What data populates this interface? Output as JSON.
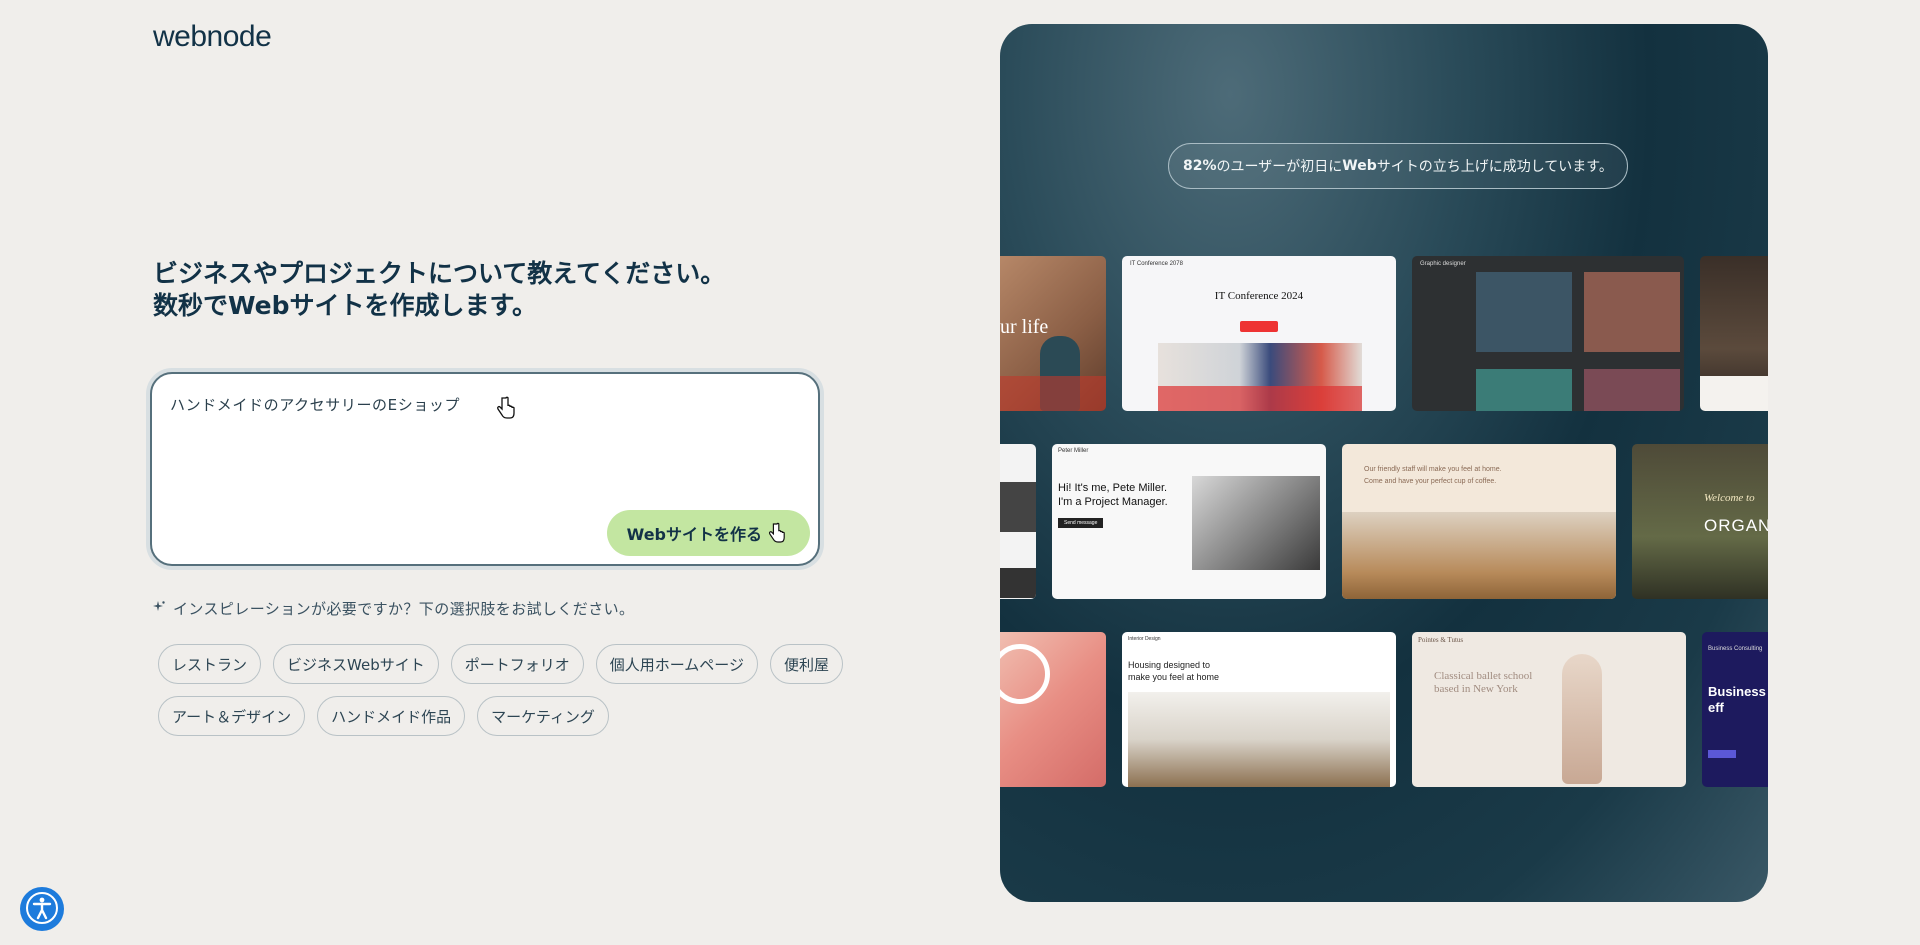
{
  "brand": {
    "logo_text": "webnode"
  },
  "headline": {
    "line1": "ビジネスやプロジェクトについて教えてください。",
    "line2": "数秒でWebサイトを作成します。"
  },
  "prompt": {
    "value": "ハンドメイドのアクセサリーのEショップ",
    "submit_label": "Webサイトを作る"
  },
  "inspiration": {
    "text": "インスピレーションが必要ですか？下の選択肢をお試しください。",
    "chips": [
      "レストラン",
      "ビジネスWebサイト",
      "ポートフォリオ",
      "個人用ホームページ",
      "便利屋",
      "アート＆デザイン",
      "ハンドメイド作品",
      "マーケティング"
    ]
  },
  "showcase": {
    "stat_highlight": "82%",
    "stat_rest": "のユーザーが初日に",
    "stat_bold2": "Web",
    "stat_tail": "サイトの立ち上げに成功しています。",
    "templates": {
      "yoga_text": "our life",
      "conf_small": "IT Conference 2078",
      "conf_title": "IT Conference 2024",
      "graphic_title": "Graphic designer",
      "pm_name": "Peter Miller",
      "pm_text1": "Hi! It's me, Pete Miller.",
      "pm_text2": "I'm a Project Manager.",
      "pm_btn": "Send message",
      "cafe_line1": "Our friendly staff will make you feel at home.",
      "cafe_line2": "Come and have your perfect cup of coffee.",
      "organic_text": "ORGAN",
      "organic_welcome": "Welcome to",
      "interior_brand": "Interior Design",
      "interior_title1": "Housing designed to",
      "interior_title2": "make you feel at home",
      "ballet_brand": "Pointes & Tutus",
      "ballet_title": "Classical ballet school based in New York",
      "consult_brand": "Business Consulting",
      "consult_title": "Business solved eff"
    }
  },
  "colors": {
    "background": "#f0eeeb",
    "primary_text": "#123247",
    "button_green": "#c3e6a1",
    "accessibility_blue": "#1d7bdc",
    "panel_dark": "#13313f"
  },
  "icons": [
    "sparkle-icon",
    "hand-cursor-icon",
    "accessibility-icon"
  ]
}
